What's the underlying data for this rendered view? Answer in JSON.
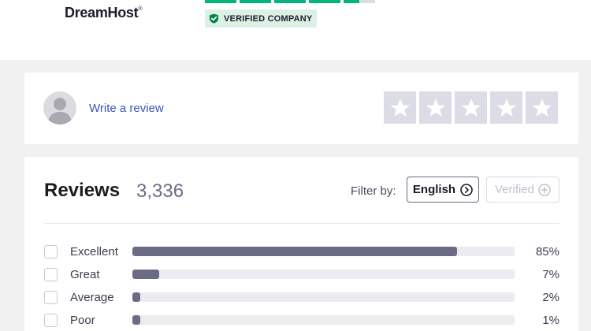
{
  "company": {
    "name": "DreamHost",
    "trademark": "®",
    "trust_bar_fill": 4.5,
    "verified_label": "VERIFIED COMPANY"
  },
  "write_review": {
    "link_text": "Write a review",
    "star_count": 5
  },
  "reviews": {
    "title": "Reviews",
    "count": "3,336",
    "filter_label": "Filter by:",
    "language_button": "English",
    "verified_button": "Verified",
    "breakdown": [
      {
        "label": "Excellent",
        "percent": 85,
        "percent_text": "85%"
      },
      {
        "label": "Great",
        "percent": 7,
        "percent_text": "7%"
      },
      {
        "label": "Average",
        "percent": 2,
        "percent_text": "2%"
      },
      {
        "label": "Poor",
        "percent": 1,
        "percent_text": "1%"
      }
    ]
  },
  "colors": {
    "trust_green": "#00b67a",
    "link_blue": "#3c57bc",
    "bar_fill": "#6b6b85",
    "bar_track": "#ebebf0",
    "empty_star_bg": "#dcdce6"
  },
  "icons": {
    "verified": "shield-check-icon",
    "avatar": "user-silhouette-icon",
    "star": "star-icon",
    "language_button": "chevron-circle-icon",
    "verified_button": "plus-circle-icon"
  }
}
